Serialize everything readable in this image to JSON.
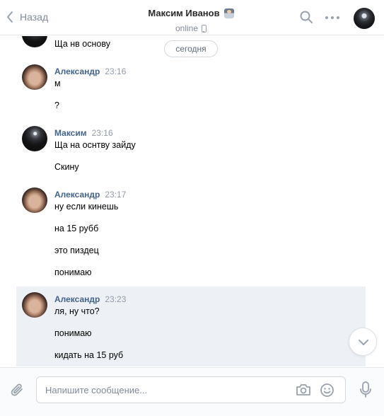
{
  "header": {
    "back_label": "Назад",
    "title": "Максим Иванов",
    "status": "online"
  },
  "chat": {
    "date_divider": "сегодня",
    "top_fragment": "Ща нв основу",
    "groups": [
      {
        "author": "Александр",
        "time": "23:16",
        "lines": [
          "м",
          "?"
        ]
      },
      {
        "author": "Максим",
        "time": "23:16",
        "lines": [
          "Ща на оснтву зайду",
          "Скину"
        ]
      },
      {
        "author": "Александр",
        "time": "23:17",
        "lines": [
          "ну если кинешь",
          "на 15 рубб",
          "это пиздец",
          "понимаю"
        ]
      },
      {
        "author": "Александр",
        "time": "23:23",
        "lines": [
          "ля, ну что?",
          "понимаю",
          "кидать на 15 руб"
        ]
      }
    ]
  },
  "composer": {
    "placeholder": "Напишите сообщение...",
    "value": ""
  },
  "icons": {
    "back": "chevron-left-icon",
    "search": "search-icon",
    "more": "more-dots-icon",
    "attach": "paperclip-icon",
    "camera": "camera-icon",
    "emoji": "smile-icon",
    "mic": "microphone-icon",
    "scroll": "chevron-down-icon"
  },
  "colors": {
    "author": "#42648b",
    "muted": "#828a99",
    "highlight_bg": "#edf0f5",
    "icon_gray": "#99a2ad"
  }
}
